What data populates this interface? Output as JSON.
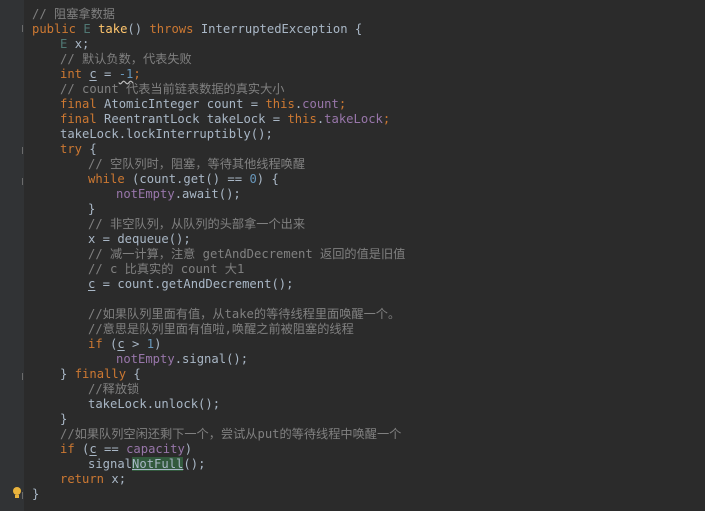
{
  "lines": [
    "// 阻塞拿数据",
    "public E take() throws InterruptedException {",
    "E x;",
    "// 默认负数，代表失败",
    "int c = -1;",
    "// count 代表当前链表数据的真实大小",
    "final AtomicInteger count = this.count;",
    "final ReentrantLock takeLock = this.takeLock;",
    "takeLock.lockInterruptibly();",
    "try {",
    "// 空队列时，阻塞，等待其他线程唤醒",
    "while (count.get() == 0) {",
    "notEmpty.await();",
    "}",
    "// 非空队列，从队列的头部拿一个出来",
    "x = dequeue();",
    "// 减一计算，注意 getAndDecrement 返回的值是旧值",
    "// c 比真实的 count 大1",
    "c = count.getAndDecrement();",
    "",
    "//如果队列里面有值，从take的等待线程里面唤醒一个。",
    "//意思是队列里面有值啦,唤醒之前被阻塞的线程",
    "if (c > 1)",
    "notEmpty.signal();",
    "} finally {",
    "//释放锁",
    "takeLock.unlock();",
    "}",
    "//如果队列空闲还剩下一个，尝试从put的等待线程中唤醒一个",
    "if (c == capacity)",
    "signalNotFull();",
    "return x;",
    "}"
  ],
  "tokens": {
    "l1_public": "public",
    "l1_E": "E",
    "l1_take": "take",
    "l1_paren": "()",
    "l1_throws": "throws",
    "l1_exc": "InterruptedException {",
    "l2_E": "E",
    "l2_x": "x;",
    "l4_int": "int",
    "l4_c": "c",
    "l4_eq": " = ",
    "l4_m1": "-1",
    "l4_semi": ";",
    "l6_final": "final",
    "l6_type": "AtomicInteger count = ",
    "l6_this": "this",
    "l6_dot": ".",
    "l6_field": "count",
    "l6_semi": ";",
    "l7_final": "final",
    "l7_type": "ReentrantLock takeLock = ",
    "l7_this": "this",
    "l7_dot": ".",
    "l7_field": "takeLock",
    "l7_semi": ";",
    "l9_try": "try",
    "l9_brace": " {",
    "l11_while": "while",
    "l11_a": " (count.get() == ",
    "l11_zero": "0",
    "l11_b": ") {",
    "l12_field": "notEmpty",
    "l12_rest": ".await();",
    "l18_c": "c",
    "l18_rest": " = count.getAndDecrement();",
    "l22_if": "if",
    "l22_a": " (",
    "l22_c": "c",
    "l22_b": " > ",
    "l22_one": "1",
    "l22_close": ")",
    "l23_field": "notEmpty",
    "l23_rest": ".signal();",
    "l24_a": "} ",
    "l24_finally": "finally",
    "l24_b": " {",
    "l29_if": "if",
    "l29_a": " (",
    "l29_c": "c",
    "l29_b": " == ",
    "l29_cap": "capacity",
    "l29_close": ")",
    "l30_a": "signal",
    "l30_hl": "NotFull",
    "l30_b": "();",
    "l31_return": "return",
    "l31_rest": " x;"
  },
  "colors": {
    "background": "#2b2b2b",
    "text": "#a9b7c6",
    "comment": "#808080",
    "keyword": "#cc7832",
    "number": "#6897bb",
    "field": "#9876aa",
    "method": "#ffc66d",
    "highlight": "#32593d",
    "bulb": "#e9b33c"
  },
  "icons": [
    "intention-bulb-icon",
    "fold-marker-icon"
  ]
}
